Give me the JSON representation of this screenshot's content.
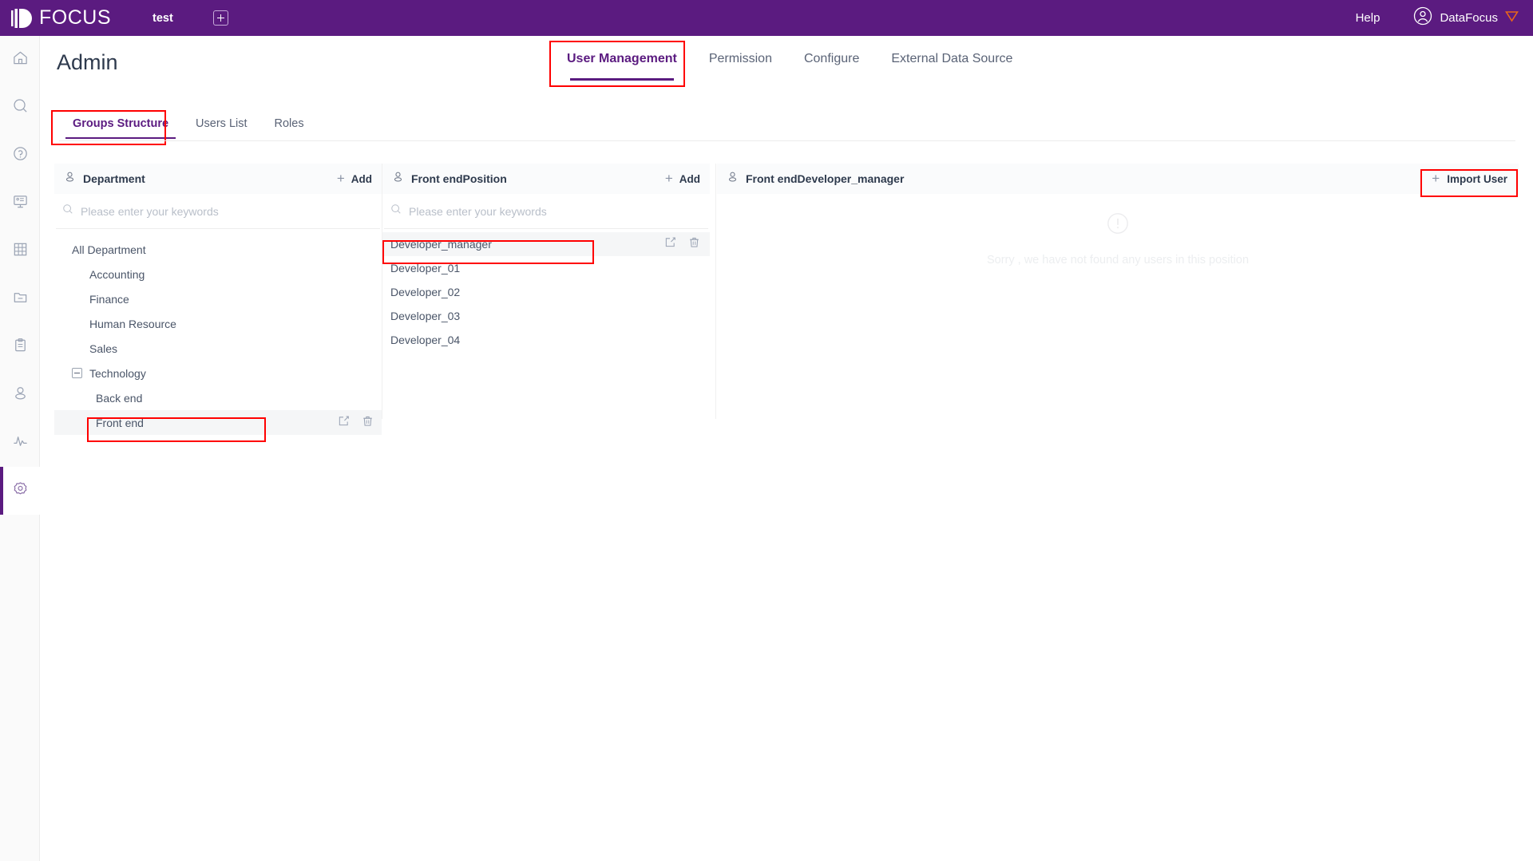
{
  "topbar": {
    "logo_text": "FOCUS",
    "logo_icon": "focus-logo-icon",
    "tab_label": "test",
    "add_tab_icon": "plus-square-icon",
    "help_label": "Help",
    "user_name": "DataFocus",
    "user_avatar_icon": "user-circle-icon",
    "user_badge_icon": "shield-caret-icon",
    "background": "#5B1B80"
  },
  "rail": {
    "items": [
      {
        "icon": "home-icon",
        "name": "home",
        "active": false
      },
      {
        "icon": "search-icon",
        "name": "search",
        "active": false
      },
      {
        "icon": "question-icon",
        "name": "help",
        "active": false
      },
      {
        "icon": "presentation-icon",
        "name": "dashboard",
        "active": false
      },
      {
        "icon": "grid-icon",
        "name": "table",
        "active": false
      },
      {
        "icon": "folder-icon",
        "name": "folder",
        "active": false
      },
      {
        "icon": "clipboard-icon",
        "name": "clipboard",
        "active": false
      },
      {
        "icon": "user-icon",
        "name": "users",
        "active": false
      },
      {
        "icon": "pulse-icon",
        "name": "monitor",
        "active": false
      },
      {
        "icon": "gear-icon",
        "name": "admin",
        "active": true
      }
    ],
    "active_color": "#5B1B80"
  },
  "page": {
    "title": "Admin"
  },
  "mainnav": {
    "items": [
      {
        "label": "User Management",
        "active": true
      },
      {
        "label": "Permission",
        "active": false
      },
      {
        "label": "Configure",
        "active": false
      },
      {
        "label": "External Data Source",
        "active": false
      }
    ],
    "accent": "#5B1B80",
    "highlight_color": "#ff0000"
  },
  "subnav": {
    "items": [
      {
        "label": "Groups Structure",
        "active": true
      },
      {
        "label": "Users List",
        "active": false
      },
      {
        "label": "Roles",
        "active": false
      }
    ]
  },
  "department_panel": {
    "icon": "person-outline-icon",
    "title": "Department",
    "add_label": "Add",
    "add_icon": "plus-icon",
    "search_placeholder": "Please enter your keywords",
    "search_value": "",
    "search_icon": "search-icon",
    "tree": [
      {
        "label": "All Department",
        "indent": 0,
        "toggle": false,
        "selected": false,
        "actions": false
      },
      {
        "label": "Accounting",
        "indent": 1,
        "toggle": false,
        "selected": false,
        "actions": false
      },
      {
        "label": "Finance",
        "indent": 1,
        "toggle": false,
        "selected": false,
        "actions": false
      },
      {
        "label": "Human Resource",
        "indent": 1,
        "toggle": false,
        "selected": false,
        "actions": false
      },
      {
        "label": "Sales",
        "indent": 1,
        "toggle": false,
        "selected": false,
        "actions": false
      },
      {
        "label": "Technology",
        "indent": 1,
        "toggle": true,
        "selected": false,
        "actions": false
      },
      {
        "label": "Back end",
        "indent": 2,
        "toggle": false,
        "selected": false,
        "actions": false
      },
      {
        "label": "Front end",
        "indent": 2,
        "toggle": false,
        "selected": true,
        "actions": true
      }
    ],
    "edit_icon": "edit-square-icon",
    "delete_icon": "trash-icon"
  },
  "position_panel": {
    "icon": "person-outline-icon",
    "title": "Front endPosition",
    "add_label": "Add",
    "add_icon": "plus-icon",
    "search_placeholder": "Please enter your keywords",
    "search_value": "",
    "search_icon": "search-icon",
    "items": [
      {
        "label": "Developer_manager",
        "selected": true,
        "actions": true
      },
      {
        "label": "Developer_01",
        "selected": false,
        "actions": false
      },
      {
        "label": "Developer_02",
        "selected": false,
        "actions": false
      },
      {
        "label": "Developer_03",
        "selected": false,
        "actions": false
      },
      {
        "label": "Developer_04",
        "selected": false,
        "actions": false
      }
    ],
    "edit_icon": "edit-square-icon",
    "delete_icon": "trash-icon"
  },
  "user_panel": {
    "icon": "person-outline-icon",
    "title": "Front endDeveloper_manager",
    "import_label": "Import User",
    "import_icon": "plus-icon",
    "empty_icon": "exclamation-circle-icon",
    "empty_text": "Sorry , we have not found any users in this position"
  }
}
